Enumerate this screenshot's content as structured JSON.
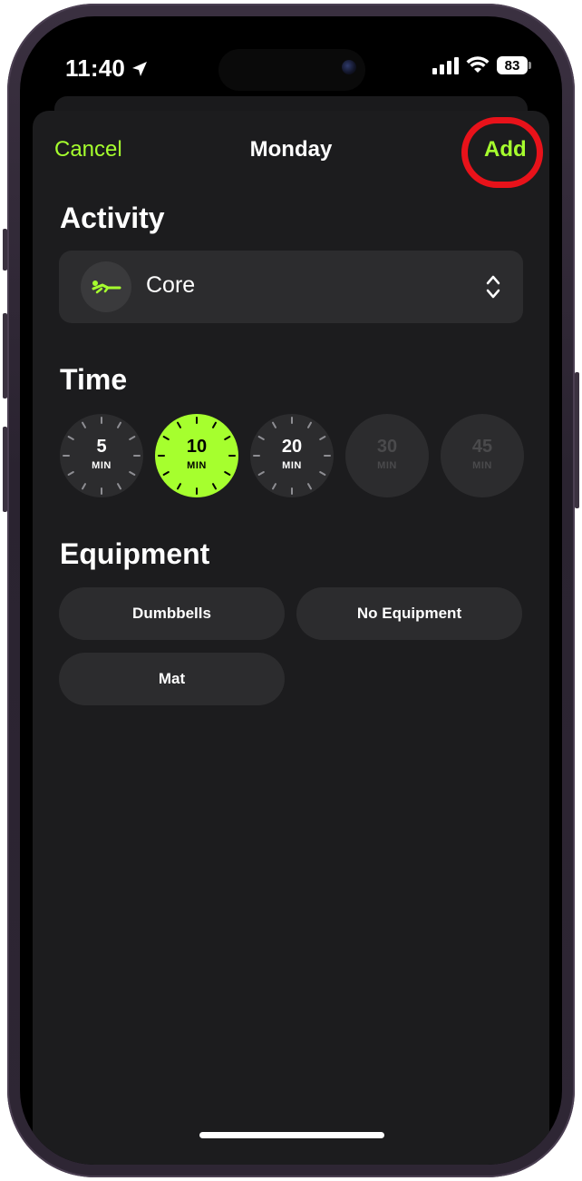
{
  "status_bar": {
    "time": "11:40",
    "location_icon": "location-arrow-icon",
    "signal_icon": "cellular-signal-icon",
    "wifi_icon": "wifi-icon",
    "battery_level": "83"
  },
  "nav": {
    "cancel_label": "Cancel",
    "title": "Monday",
    "add_label": "Add"
  },
  "activity": {
    "section_title": "Activity",
    "selected": "Core",
    "icon": "core-workout-icon",
    "chevron_icon": "up-down-chevron-icon"
  },
  "time": {
    "section_title": "Time",
    "options": [
      {
        "value": "5",
        "unit": "MIN",
        "state": "available"
      },
      {
        "value": "10",
        "unit": "MIN",
        "state": "selected"
      },
      {
        "value": "20",
        "unit": "MIN",
        "state": "available"
      },
      {
        "value": "30",
        "unit": "MIN",
        "state": "disabled"
      },
      {
        "value": "45",
        "unit": "MIN",
        "state": "disabled"
      }
    ]
  },
  "equipment": {
    "section_title": "Equipment",
    "options": [
      "Dumbbells",
      "No Equipment",
      "Mat"
    ]
  },
  "colors": {
    "accent": "#a6ff2e",
    "background": "#1c1c1e",
    "control": "#2c2c2e",
    "highlight_ring": "#e8121a"
  }
}
